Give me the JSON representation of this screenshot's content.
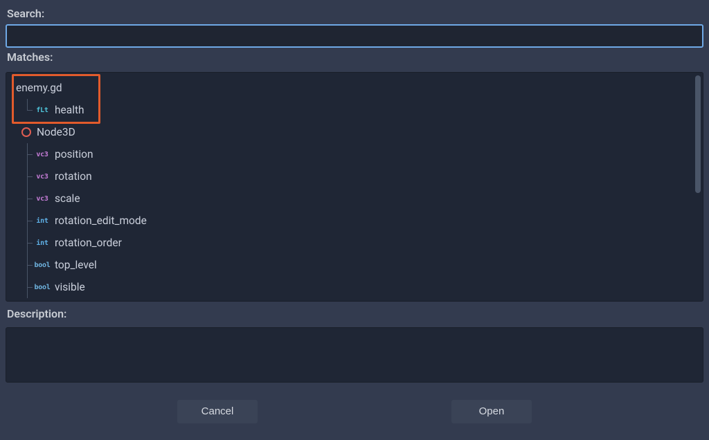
{
  "labels": {
    "search": "Search:",
    "matches": "Matches:",
    "description": "Description:"
  },
  "search": {
    "value": "",
    "placeholder": ""
  },
  "tree": {
    "script": {
      "name": "enemy.gd",
      "children": [
        {
          "type": "flt",
          "type_label": "fLt",
          "name": "health"
        }
      ]
    },
    "node": {
      "name": "Node3D",
      "icon": "node3d-icon",
      "children": [
        {
          "type": "vc3",
          "type_label": "vc3",
          "name": "position"
        },
        {
          "type": "vc3",
          "type_label": "vc3",
          "name": "rotation"
        },
        {
          "type": "vc3",
          "type_label": "vc3",
          "name": "scale"
        },
        {
          "type": "int",
          "type_label": "int",
          "name": "rotation_edit_mode"
        },
        {
          "type": "int",
          "type_label": "int",
          "name": "rotation_order"
        },
        {
          "type": "bool",
          "type_label": "bool",
          "name": "top_level"
        },
        {
          "type": "bool",
          "type_label": "bool",
          "name": "visible"
        }
      ]
    }
  },
  "description": "",
  "buttons": {
    "cancel": "Cancel",
    "open": "Open"
  },
  "colors": {
    "accent": "#6fa9e6",
    "highlight": "#e25b2c",
    "node3d": "#e05d52"
  }
}
